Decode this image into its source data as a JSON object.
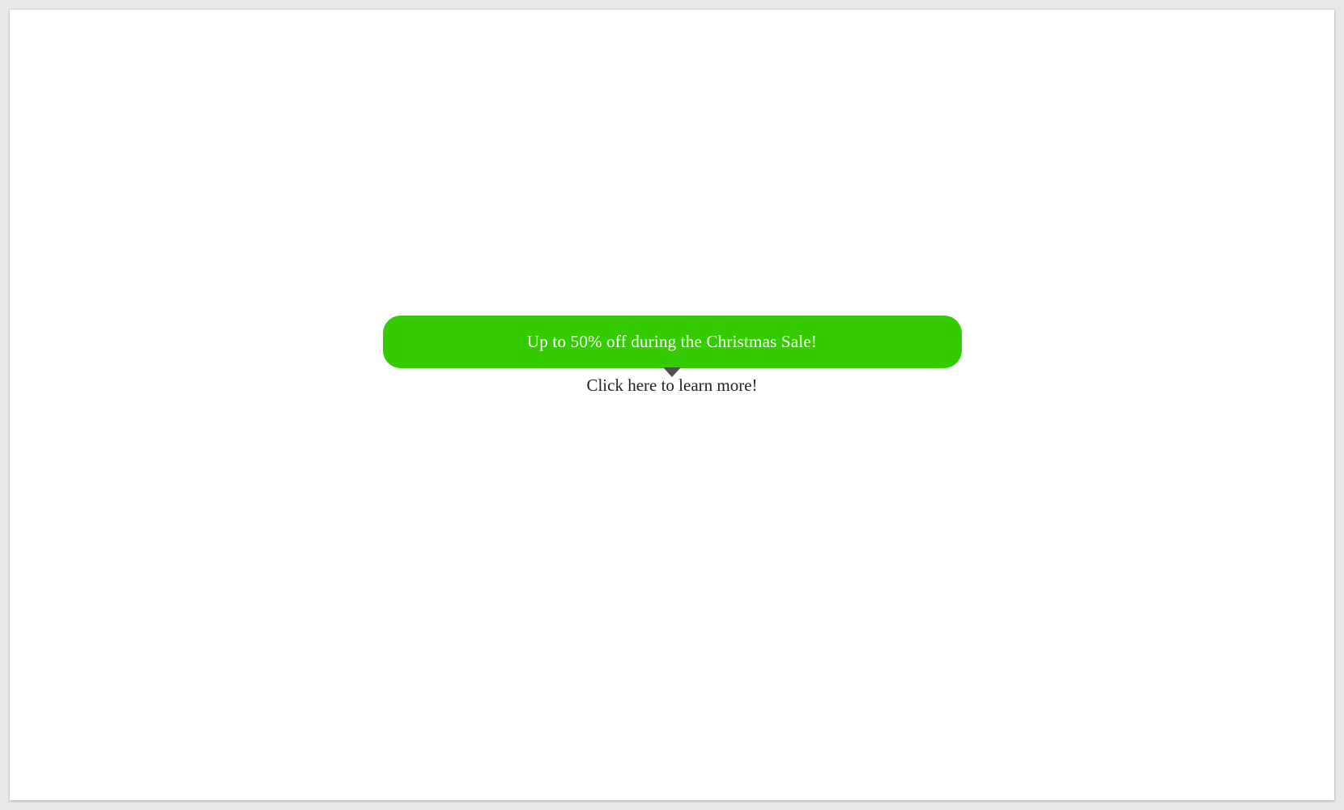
{
  "tooltip": {
    "text": "Up to 50% off during the Christmas Sale!"
  },
  "link": {
    "text": "Click here to learn more!"
  },
  "colors": {
    "tooltip_bg": "#34cc00",
    "tooltip_fg": "#ffffff",
    "page_bg": "#e7e8ea",
    "arrow": "#505050",
    "link": "#222222"
  }
}
